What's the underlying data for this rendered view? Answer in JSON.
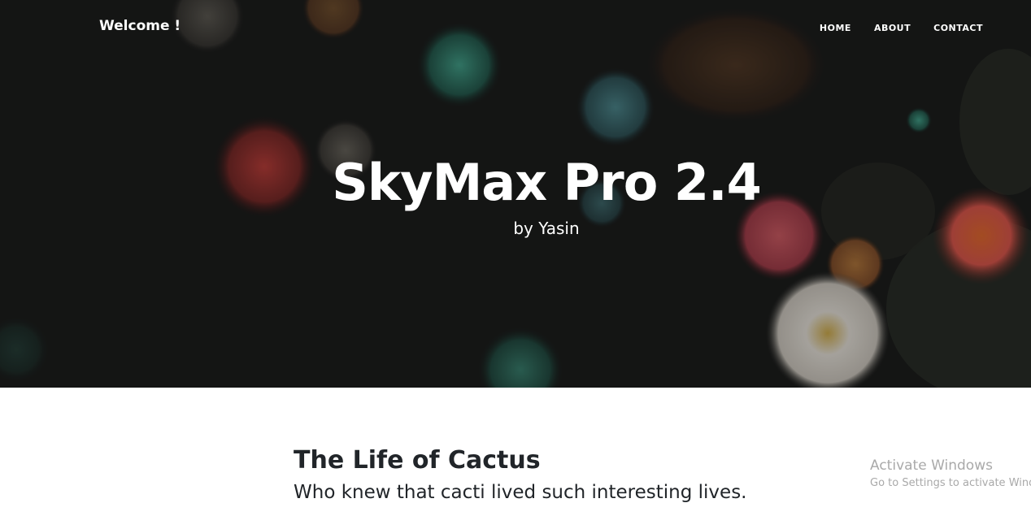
{
  "page": {
    "colors": {
      "hero_overlay": "#141514",
      "hero_text": "#ffffff",
      "body_text": "#212529",
      "watermark_text": "#a9a9a9",
      "background": "#ffffff"
    }
  },
  "navbar": {
    "brand": "Welcome !",
    "links": [
      {
        "label": "HOME"
      },
      {
        "label": "ABOUT"
      },
      {
        "label": "CONTACT"
      }
    ]
  },
  "hero": {
    "title": "SkyMax Pro 2.4",
    "subtitle": "by Yasin",
    "background_description_icon": "sea-anemone-photo"
  },
  "post": {
    "title": "The Life of Cactus",
    "subtitle": "Who knew that cacti lived such interesting lives."
  },
  "watermark": {
    "title": "Activate Windows",
    "subtitle": "Go to Settings to activate Windows."
  }
}
